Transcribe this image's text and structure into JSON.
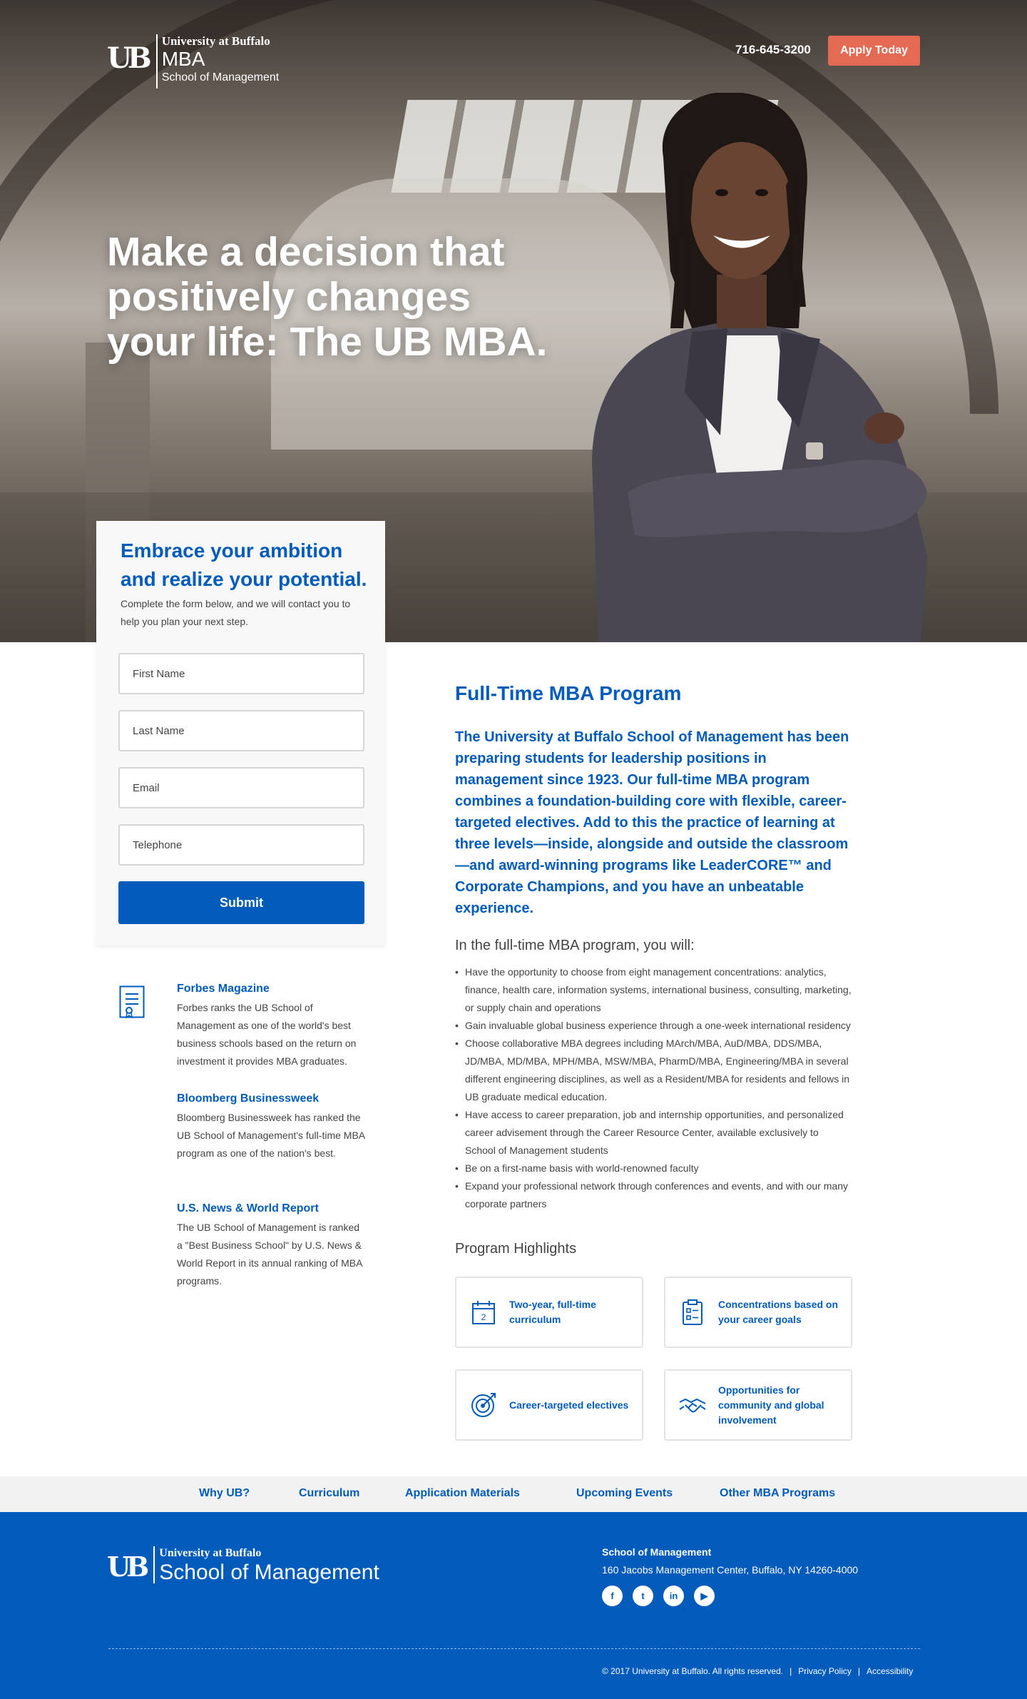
{
  "header": {
    "logo_university": "University at Buffalo",
    "logo_program": "MBA",
    "logo_school": "School of Management",
    "phone": "716-645-3200",
    "apply_label": "Apply Today"
  },
  "hero": {
    "headline": "Make a decision that positively changes your life:  The UB MBA."
  },
  "form": {
    "title": "Embrace your ambition and realize your potential.",
    "subtitle": "Complete the form below, and we will contact you to help you plan your next step.",
    "first_name_placeholder": "First Name",
    "last_name_placeholder": "Last Name",
    "email_placeholder": "Email",
    "telephone_placeholder": "Telephone",
    "submit_label": "Submit"
  },
  "rankings": [
    {
      "source": "Forbes Magazine",
      "text": "Forbes ranks the UB School of Management as one of the world's best business schools based on the return on investment it provides MBA graduates."
    },
    {
      "source": "Bloomberg Businessweek",
      "text": "Bloomberg Businessweek has ranked the UB School of Management's full-time MBA program as one of the nation's best."
    },
    {
      "source": "U.S. News & World Report",
      "text": "The UB School of Management is ranked a \"Best Business School\" by U.S. News & World Report in its annual ranking of MBA programs."
    }
  ],
  "program": {
    "title": "Full-Time MBA Program",
    "lead": "The University at Buffalo School of Management has been preparing students for leadership positions in management since 1923. Our full-time MBA program combines a foundation-building core with flexible, career-targeted electives. Add to this the practice of learning at three levels—inside, alongside and outside the classroom—and award-winning programs like LeaderCORE™ and Corporate Champions, and you have an unbeatable experience.",
    "intro": "In the full-time MBA program, you will:",
    "bullets": [
      "Have the opportunity to choose from eight management concentrations: analytics, finance, health care, information systems, international business, consulting, marketing, or supply chain and operations",
      "Gain invaluable global business experience through a one-week international residency",
      "Choose collaborative MBA degrees including MArch/MBA, AuD/MBA, DDS/MBA, JD/MBA, MD/MBA, MPH/MBA, MSW/MBA, PharmD/MBA, Engineering/MBA in several different engineering disciplines, as well as a Resident/MBA for residents and fellows in UB graduate medical education.",
      "Have access to career preparation, job and internship opportunities, and personalized career advisement through the Career Resource Center, available exclusively to School of Management students",
      "Be on a first-name basis with world-renowned faculty",
      "Expand your professional network through conferences and events, and with our many corporate partners"
    ]
  },
  "highlights": {
    "title": "Program Highlights",
    "items": [
      {
        "label": "Two-year, full-time curriculum",
        "icon": "calendar-icon",
        "icon_text": "2"
      },
      {
        "label": "Concentrations based on your career goals",
        "icon": "checklist-icon"
      },
      {
        "label": "Career-targeted electives",
        "icon": "target-icon"
      },
      {
        "label": "Opportunities for community and global involvement",
        "icon": "handshake-icon"
      }
    ]
  },
  "subnav": [
    "Why UB?",
    "Curriculum",
    "Application Materials",
    "Upcoming Events",
    "Other MBA Programs"
  ],
  "footer": {
    "logo_university": "University at Buffalo",
    "logo_school": "School of Management",
    "address_title": "School of Management",
    "address": "160 Jacobs Management Center, Buffalo, NY 14260-4000",
    "social": [
      {
        "name": "facebook",
        "glyph": "f"
      },
      {
        "name": "twitter",
        "glyph": "t"
      },
      {
        "name": "linkedin",
        "glyph": "in"
      },
      {
        "name": "youtube",
        "glyph": "▶"
      }
    ],
    "copyright": "© 2017 University at Buffalo. All rights reserved.",
    "separator": "|",
    "privacy": "Privacy Policy",
    "accessibility": "Accessibility"
  },
  "colors": {
    "brand_blue": "#005bbb",
    "apply_orange": "#e56a54",
    "subnav_bg": "#f2f2f2"
  }
}
